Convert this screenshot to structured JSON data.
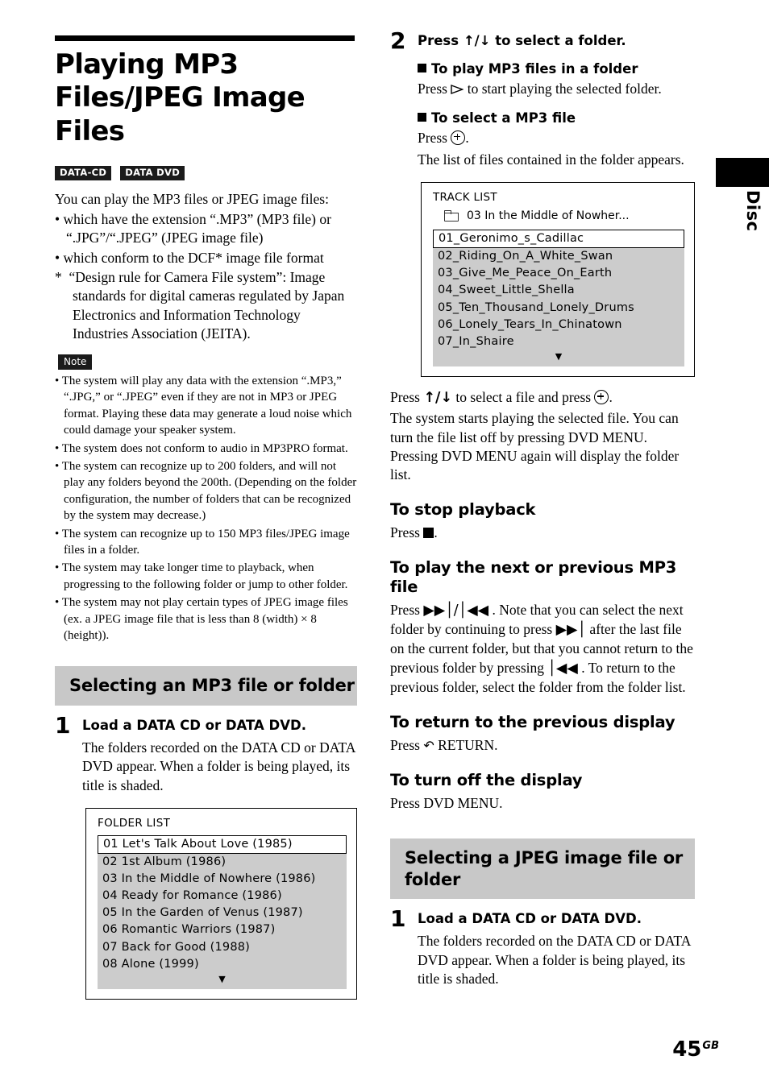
{
  "page": {
    "number": "45",
    "number_suffix": "GB",
    "thumb_label": "Disc"
  },
  "title": "Playing MP3 Files/JPEG Image Files",
  "badges": [
    {
      "label": "DATA-CD"
    },
    {
      "label": "DATA DVD"
    }
  ],
  "intro": {
    "lead": "You can play the MP3 files or JPEG image files:",
    "bullets": [
      "which have the extension “.MP3” (MP3 file) or “.JPG”/“.JPEG” (JPEG image file)",
      "which conform to the DCF* image file format"
    ],
    "footnote": "*  “Design rule for Camera File system”: Image standards for digital cameras regulated by Japan Electronics and Information Technology Industries Association (JEITA)."
  },
  "note": {
    "label": "Note",
    "items": [
      "The system will play any data with the extension “.MP3,” “.JPG,” or “.JPEG” even if they are not in MP3 or JPEG format. Playing these data may generate a loud noise which could damage your speaker system.",
      "The system does not conform to audio in MP3PRO format.",
      "The system can recognize up to 200 folders, and will not play any folders beyond the 200th. (Depending on the folder configuration, the number of folders that can be recognized by the system may decrease.)",
      "The system can recognize up to 150 MP3 files/JPEG image files in a folder.",
      "The system may take longer time to playback, when progressing to the following folder or jump to other folder.",
      "The system may not play certain types of JPEG image files (ex. a JPEG image file that is less than 8 (width) × 8 (height))."
    ]
  },
  "section_mp3": {
    "heading": "Selecting an MP3 file or folder",
    "step1": {
      "num": "1",
      "title": "Load a DATA CD or DATA DVD.",
      "text": "The folders recorded on the DATA CD or DATA DVD appear. When a folder is being played, its title is shaded."
    },
    "folder_list": {
      "caption": "FOLDER LIST",
      "rows": [
        "01  Let's Talk About Love (1985)",
        "02  1st Album (1986)",
        "03  In the Middle of Nowhere (1986)",
        "04  Ready for Romance (1986)",
        "05  In the Garden of Venus (1987)",
        "06  Romantic Warriors (1987)",
        "07  Back for Good (1988)",
        "08  Alone (1999)"
      ],
      "scroll_arrow": "▼"
    }
  },
  "step2": {
    "num": "2",
    "title_prefix": "Press ",
    "title_arrows": "↑/↓",
    "title_suffix": " to select a folder.",
    "sub1": {
      "heading": "To play MP3 files in a folder",
      "text_before": "Press ",
      "text_after": " to start playing the selected folder."
    },
    "sub2": {
      "heading": "To select a MP3 file",
      "text_before": "Press ",
      "text_after": ".",
      "text2": "The list of files contained in the folder appears."
    }
  },
  "track_list": {
    "caption": "TRACK LIST",
    "folder_line": "03  In the Middle of Nowher...",
    "rows": [
      "01_Geronimo_s_Cadillac",
      "02_Riding_On_A_White_Swan",
      "03_Give_Me_Peace_On_Earth",
      "04_Sweet_Little_Shella",
      "05_Ten_Thousand_Lonely_Drums",
      "06_Lonely_Tears_In_Chinatown",
      "07_In_Shaire"
    ],
    "scroll_arrow": "▼"
  },
  "after_track_list": {
    "line1_before": "Press ",
    "line1_arrows": "↑/↓",
    "line1_mid": " to select a file and press ",
    "line1_after": ".",
    "paragraph": "The system starts playing the selected file. You can turn the file list off by pressing DVD MENU. Pressing DVD MENU again will display the folder list."
  },
  "to_stop": {
    "heading": "To stop playback",
    "text_before": "Press ",
    "text_after": "."
  },
  "to_next_prev": {
    "heading": "To play the next or previous MP3 file",
    "p_1": "Press ",
    "p_2": "▶▶│/│◀◀",
    "p_3": " . Note that you can select the next folder by continuing to press ",
    "p_4": "▶▶│",
    "p_5": " after the last file on the current folder, but that you cannot return to the previous folder by pressing ",
    "p_6": "│◀◀",
    "p_7": " . To return to the previous folder, select the folder from the folder list."
  },
  "to_return": {
    "heading": "To return to the previous display",
    "text_before": "Press ",
    "glyph": "↶",
    "text_after": " RETURN."
  },
  "to_turn_off": {
    "heading": "To turn off the display",
    "text": "Press DVD MENU."
  },
  "section_jpeg": {
    "heading": "Selecting a JPEG image file or folder",
    "step1": {
      "num": "1",
      "title": "Load a DATA CD or DATA DVD.",
      "text": "The folders recorded on the DATA CD or DATA DVD appear. When a folder is being played, its title is shaded."
    }
  }
}
